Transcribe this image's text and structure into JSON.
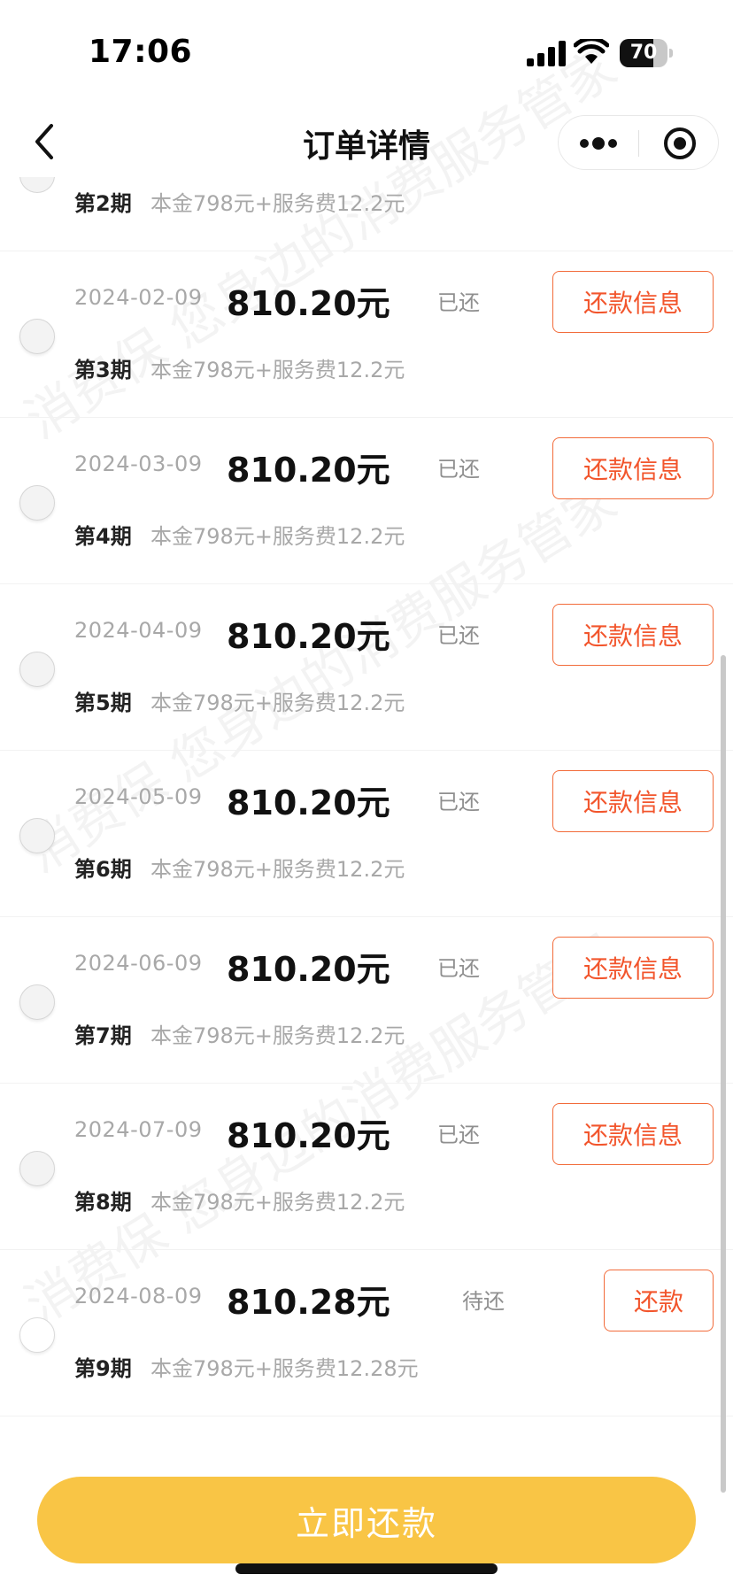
{
  "status_bar": {
    "time": "17:06",
    "battery": "70",
    "battery_level_percent": 70
  },
  "nav": {
    "title": "订单详情"
  },
  "watermark": "消费保 您身边的消费服务管家",
  "partial_row": {
    "period": "第2期",
    "detail": "本金798元+服务费12.2元"
  },
  "rows": [
    {
      "date": "2024-02-09",
      "amount": "810.20元",
      "status": "已还",
      "period": "第3期",
      "detail": "本金798元+服务费12.2元",
      "button": "还款信息"
    },
    {
      "date": "2024-03-09",
      "amount": "810.20元",
      "status": "已还",
      "period": "第4期",
      "detail": "本金798元+服务费12.2元",
      "button": "还款信息"
    },
    {
      "date": "2024-04-09",
      "amount": "810.20元",
      "status": "已还",
      "period": "第5期",
      "detail": "本金798元+服务费12.2元",
      "button": "还款信息"
    },
    {
      "date": "2024-05-09",
      "amount": "810.20元",
      "status": "已还",
      "period": "第6期",
      "detail": "本金798元+服务费12.2元",
      "button": "还款信息"
    },
    {
      "date": "2024-06-09",
      "amount": "810.20元",
      "status": "已还",
      "period": "第7期",
      "detail": "本金798元+服务费12.2元",
      "button": "还款信息"
    },
    {
      "date": "2024-07-09",
      "amount": "810.20元",
      "status": "已还",
      "period": "第8期",
      "detail": "本金798元+服务费12.2元",
      "button": "还款信息"
    },
    {
      "date": "2024-08-09",
      "amount": "810.28元",
      "status": "待还",
      "period": "第9期",
      "detail": "本金798元+服务费12.28元",
      "button": "还款"
    }
  ],
  "pay_button": "立即还款",
  "colors": {
    "accent": "#f2552c",
    "pay_button": "#f9c545"
  },
  "icons": {
    "back": "chevron-left-icon",
    "more": "more-dots-icon",
    "close": "target-close-icon"
  }
}
